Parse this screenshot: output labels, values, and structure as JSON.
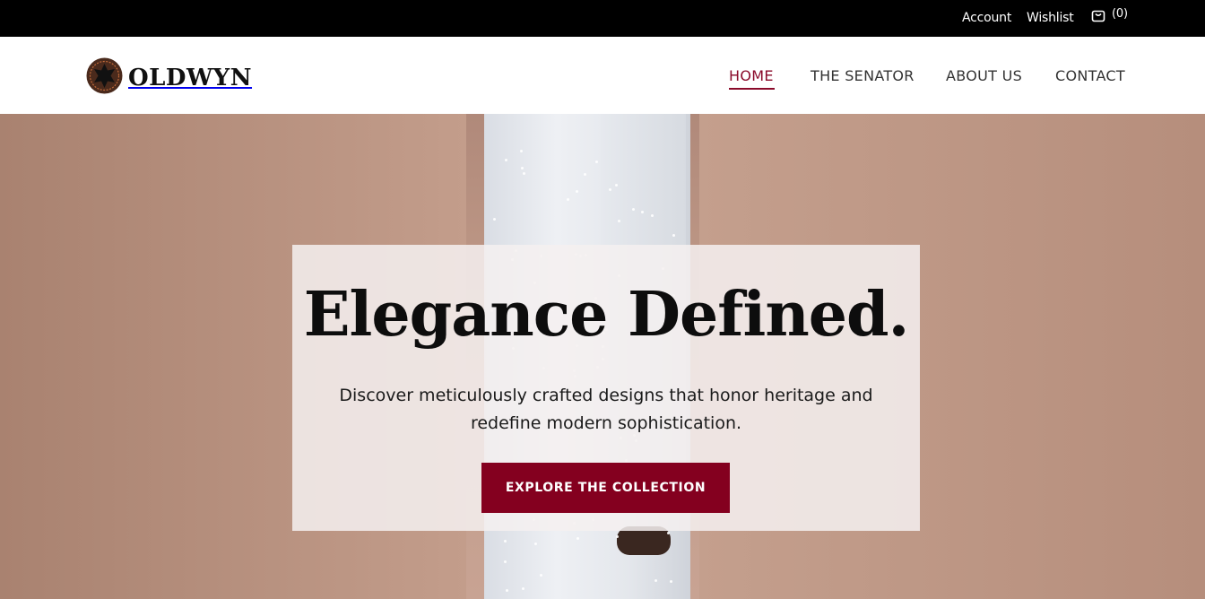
{
  "topbar": {
    "account_label": "Account",
    "wishlist_label": "Wishlist",
    "cart_count": "(0)",
    "cart_icon": "shopping-bag-icon"
  },
  "header": {
    "brand": "OLDWYN",
    "logo_icon": "brand-emblem-icon",
    "nav": {
      "home": "HOME",
      "senator": "THE SENATOR",
      "about": "ABOUT US",
      "contact": "CONTACT"
    },
    "active_item": "HOME"
  },
  "hero": {
    "title": "Elegance Defined.",
    "subtitle": "Discover meticulously crafted designs that honor heritage and redefine modern sophistication.",
    "cta_label": "EXPLORE THE COLLECTION"
  },
  "colors": {
    "accent": "#84001f",
    "nav_active": "#8a0a2a",
    "topbar_bg": "#000000",
    "hero_bg": "#c09a88"
  }
}
